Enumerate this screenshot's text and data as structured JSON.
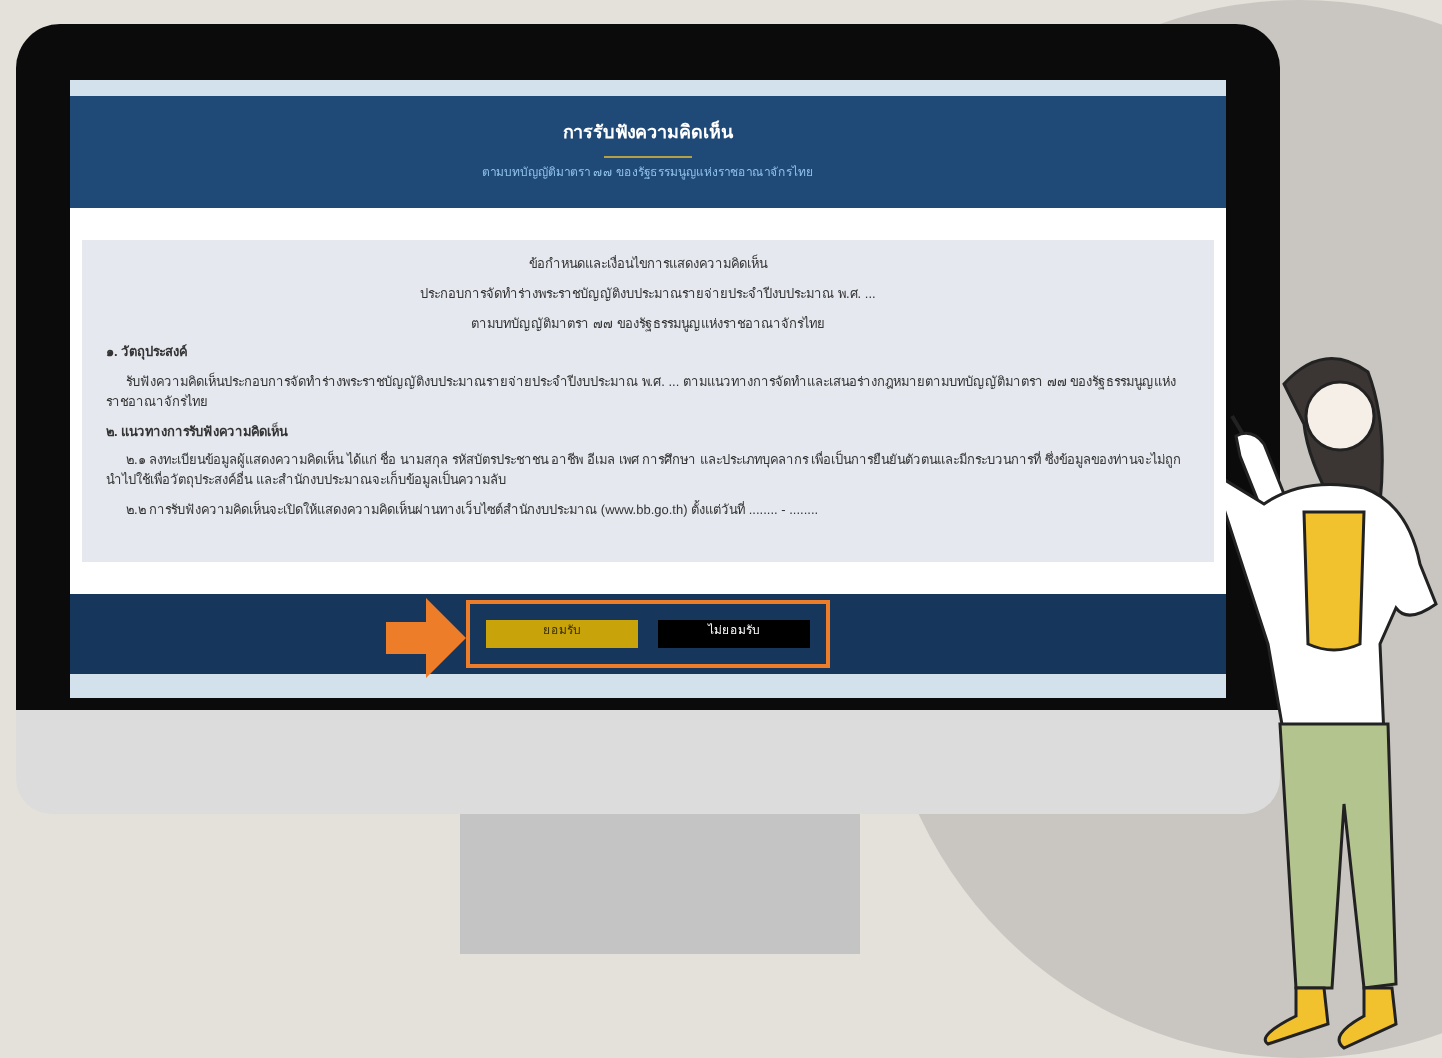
{
  "header": {
    "title": "การรับฟังความคิดเห็น",
    "subtitle": "ตามบทบัญญัติมาตรา ๗๗ ของรัฐธรรมนูญแห่งราชอาณาจักรไทย"
  },
  "notice": {
    "headings": [
      "ข้อกำหนดและเงื่อนไขการแสดงความคิดเห็น",
      "ประกอบการจัดทำร่างพระราชบัญญัติงบประมาณรายจ่ายประจำปีงบประมาณ พ.ศ. ...",
      "ตามบทบัญญัติมาตรา ๗๗ ของรัฐธรรมนูญแห่งราชอาณาจักรไทย"
    ],
    "sections": [
      {
        "heading": "๑. วัตถุประสงค์",
        "paragraphs": [
          "รับฟังความคิดเห็นประกอบการจัดทำร่างพระราชบัญญัติงบประมาณรายจ่ายประจำปีงบประมาณ พ.ศ. ... ตามแนวทางการจัดทำและเสนอร่างกฎหมายตามบทบัญญัติมาตรา ๗๗ ของรัฐธรรมนูญแห่งราชอาณาจักรไทย"
        ]
      },
      {
        "heading": "๒. แนวทางการรับฟังความคิดเห็น",
        "paragraphs": [
          "๒.๑ ลงทะเบียนข้อมูลผู้แสดงความคิดเห็น ได้แก่ ชื่อ นามสกุล รหัสบัตรประชาชน อาชีพ อีเมล เพศ การศึกษา และประเภทบุคลากร เพื่อเป็นการยืนยันตัวตนและมีกระบวนการที่ ซึ่งข้อมูลของท่านจะไม่ถูกนำไปใช้เพื่อวัตถุประสงค์อื่น และสำนักงบประมาณจะเก็บข้อมูลเป็นความลับ",
          "๒.๒ การรับฟังความคิดเห็นจะเปิดให้แสดงความคิดเห็นผ่านทางเว็บไซต์สำนักงบประมาณ (www.bb.go.th) ตั้งแต่วันที่ ........ - ........"
        ]
      }
    ]
  },
  "buttons": [
    {
      "label": "ยอมรับ",
      "kind": "accept"
    },
    {
      "label": "ไม่ยอมรับ",
      "kind": "decline"
    }
  ]
}
